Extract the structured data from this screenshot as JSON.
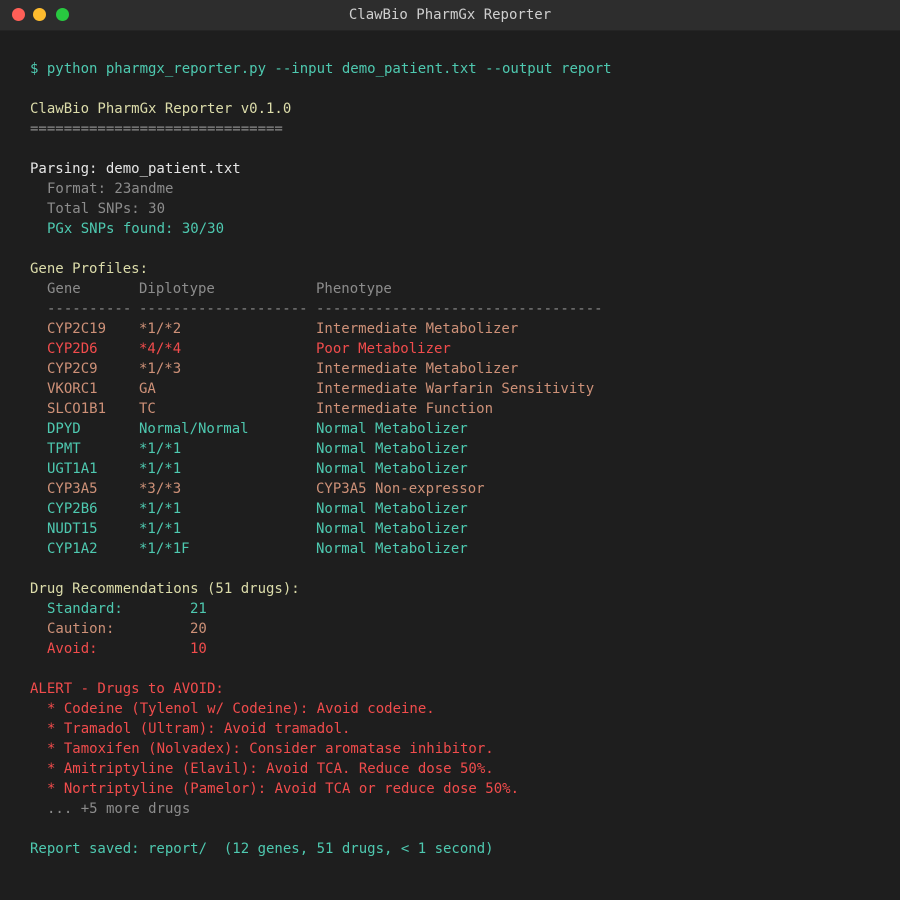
{
  "window": {
    "title": "ClawBio PharmGx Reporter"
  },
  "command": "$ python pharmgx_reporter.py --input demo_patient.txt --output report",
  "header": {
    "name": "ClawBio PharmGx Reporter v0.1.0",
    "rule": "=============================="
  },
  "parsing": {
    "title": "Parsing: demo_patient.txt",
    "format": "Format: 23andme",
    "total_snps": "Total SNPs: 30",
    "pgx_found": "PGx SNPs found: 30/30"
  },
  "gene_profiles": {
    "title": "Gene Profiles:",
    "headers": [
      "Gene",
      "Diplotype",
      "Phenotype"
    ],
    "separators": [
      "----------",
      "--------------------",
      "----------------------------------"
    ],
    "rows": [
      {
        "gene": "CYP2C19",
        "diplotype": "*1/*2",
        "phenotype": "Intermediate Metabolizer",
        "status": "caution"
      },
      {
        "gene": "CYP2D6",
        "diplotype": "*4/*4",
        "phenotype": "Poor Metabolizer",
        "status": "avoid"
      },
      {
        "gene": "CYP2C9",
        "diplotype": "*1/*3",
        "phenotype": "Intermediate Metabolizer",
        "status": "caution"
      },
      {
        "gene": "VKORC1",
        "diplotype": "GA",
        "phenotype": "Intermediate Warfarin Sensitivity",
        "status": "caution"
      },
      {
        "gene": "SLCO1B1",
        "diplotype": "TC",
        "phenotype": "Intermediate Function",
        "status": "caution"
      },
      {
        "gene": "DPYD",
        "diplotype": "Normal/Normal",
        "phenotype": "Normal Metabolizer",
        "status": "normal"
      },
      {
        "gene": "TPMT",
        "diplotype": "*1/*1",
        "phenotype": "Normal Metabolizer",
        "status": "normal"
      },
      {
        "gene": "UGT1A1",
        "diplotype": "*1/*1",
        "phenotype": "Normal Metabolizer",
        "status": "normal"
      },
      {
        "gene": "CYP3A5",
        "diplotype": "*3/*3",
        "phenotype": "CYP3A5 Non-expressor",
        "status": "caution"
      },
      {
        "gene": "CYP2B6",
        "diplotype": "*1/*1",
        "phenotype": "Normal Metabolizer",
        "status": "normal"
      },
      {
        "gene": "NUDT15",
        "diplotype": "*1/*1",
        "phenotype": "Normal Metabolizer",
        "status": "normal"
      },
      {
        "gene": "CYP1A2",
        "diplotype": "*1/*1F",
        "phenotype": "Normal Metabolizer",
        "status": "normal"
      }
    ]
  },
  "drug_recs": {
    "title": "Drug Recommendations (51 drugs):",
    "items": [
      {
        "label": "Standard:",
        "value": "21",
        "status": "normal"
      },
      {
        "label": "Caution:",
        "value": "20",
        "status": "caution"
      },
      {
        "label": "Avoid:",
        "value": "10",
        "status": "avoid"
      }
    ]
  },
  "alert": {
    "title": "ALERT - Drugs to AVOID:",
    "items": [
      "* Codeine (Tylenol w/ Codeine): Avoid codeine.",
      "* Tramadol (Ultram): Avoid tramadol.",
      "* Tamoxifen (Nolvadex): Consider aromatase inhibitor.",
      "* Amitriptyline (Elavil): Avoid TCA. Reduce dose 50%.",
      "* Nortriptyline (Pamelor): Avoid TCA or reduce dose 50%."
    ],
    "more": "... +5 more drugs"
  },
  "footer": "Report saved: report/  (12 genes, 51 drugs, < 1 second)",
  "colors": {
    "background": "#1e1e1e",
    "titlebar": "#2d2d2d",
    "teal": "#4ec9b0",
    "yellow": "#dcdcaa",
    "orange": "#ce9178",
    "red": "#f14c4c",
    "gray": "#8c8c8c"
  }
}
